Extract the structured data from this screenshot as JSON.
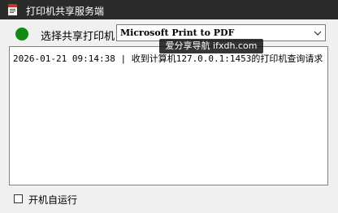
{
  "window": {
    "title": "打印机共享服务端",
    "app_icon": "printer-app-icon"
  },
  "printer": {
    "label": "选择共享打印机",
    "selected": "Microsoft Print to PDF",
    "status_color": "#118a11"
  },
  "watermark": {
    "text": "爱分享导航 ifxdh.com"
  },
  "log": {
    "entries": [
      "2026-01-21 09:14:38 | 收到计算机127.0.0.1:1453的打印机查询请求"
    ]
  },
  "options": {
    "autostart_label": "开机自运行",
    "autostart_checked": false
  }
}
